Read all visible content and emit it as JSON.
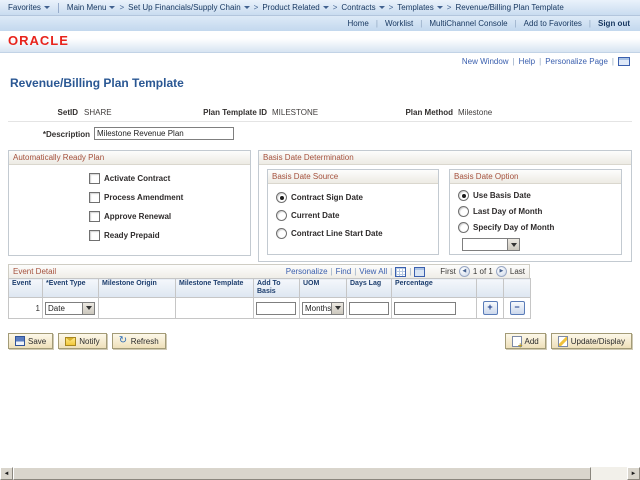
{
  "breadcrumb": {
    "favorites": "Favorites",
    "main_menu": "Main Menu",
    "path": [
      "Set Up Financials/Supply Chain",
      "Product Related",
      "Contracts",
      "Templates",
      "Revenue/Billing Plan Template"
    ]
  },
  "utility_nav": {
    "home": "Home",
    "worklist": "Worklist",
    "multichannel": "MultiChannel Console",
    "add_to_favorites": "Add to Favorites",
    "sign_out": "Sign out"
  },
  "brand": {
    "logo": "ORACLE"
  },
  "page_links": {
    "new_window": "New Window",
    "help": "Help",
    "personalize_page": "Personalize Page"
  },
  "page": {
    "title": "Revenue/Billing Plan Template"
  },
  "header_fields": {
    "setid_label": "SetID",
    "setid_value": "SHARE",
    "plan_template_id_label": "Plan Template ID",
    "plan_template_id_value": "MILESTONE",
    "plan_method_label": "Plan Method",
    "plan_method_value": "Milestone",
    "description_label": "*Description",
    "description_value": "Milestone Revenue Plan"
  },
  "auto_ready_plan": {
    "title": "Automatically Ready Plan",
    "checkboxes": [
      {
        "label": "Activate Contract",
        "checked": false
      },
      {
        "label": "Process Amendment",
        "checked": false
      },
      {
        "label": "Approve Renewal",
        "checked": false
      },
      {
        "label": "Ready Prepaid",
        "checked": false
      }
    ]
  },
  "basis_date": {
    "title": "Basis Date Determination",
    "source": {
      "title": "Basis Date Source",
      "options": [
        {
          "label": "Contract Sign Date",
          "selected": true
        },
        {
          "label": "Current Date",
          "selected": false
        },
        {
          "label": "Contract Line Start Date",
          "selected": false
        }
      ]
    },
    "option": {
      "title": "Basis Date Option",
      "options": [
        {
          "label": "Use Basis Date",
          "selected": true
        },
        {
          "label": "Last Day of Month",
          "selected": false
        },
        {
          "label": "Specify Day of Month",
          "selected": false
        }
      ],
      "day_select_value": ""
    }
  },
  "event_detail": {
    "title": "Event Detail",
    "toolbar": {
      "personalize": "Personalize",
      "find": "Find",
      "view_all": "View All"
    },
    "pager": {
      "first": "First",
      "position": "1 of 1",
      "last": "Last"
    },
    "columns": [
      "Event",
      "*Event Type",
      "Milestone Origin",
      "Milestone Template",
      "Add To Basis",
      "UOM",
      "Days Lag",
      "Percentage"
    ],
    "rows": [
      {
        "event": "1",
        "event_type": "Date",
        "milestone_origin": "",
        "milestone_template": "",
        "add_to_basis": "",
        "uom": "Months",
        "days_lag": "",
        "percentage": ""
      }
    ]
  },
  "toolbar": {
    "save": "Save",
    "notify": "Notify",
    "refresh": "Refresh",
    "add": "Add",
    "update_display": "Update/Display"
  },
  "colors": {
    "oracle_red": "#e8241c",
    "group_header_text": "#a5513d",
    "link_blue": "#3a5fae",
    "nav_text": "#16365f",
    "title_blue": "#2a5793"
  }
}
